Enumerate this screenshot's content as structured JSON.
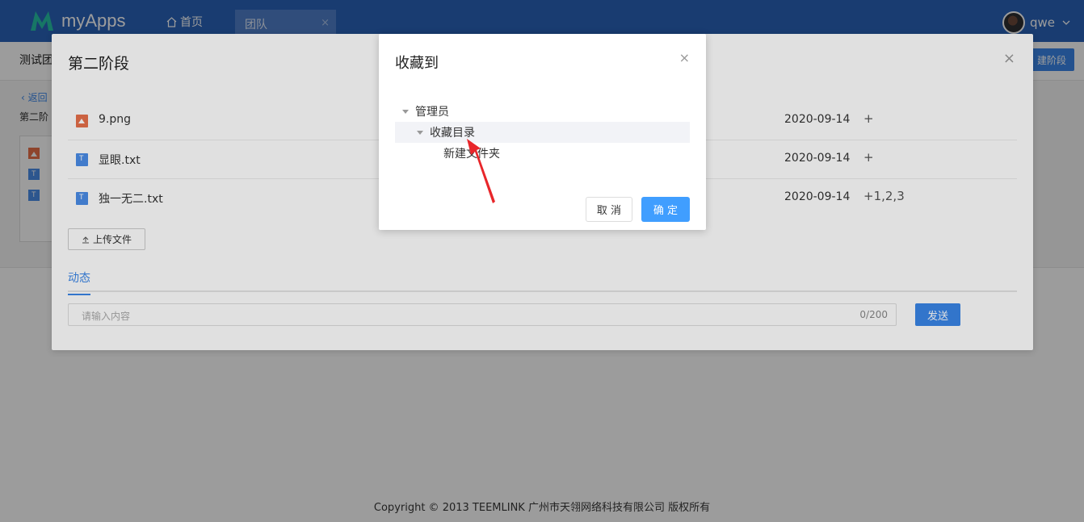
{
  "app": {
    "name": "myApps"
  },
  "nav": {
    "home_label": "首页",
    "tab_label": "团队",
    "tab_close": "×"
  },
  "user": {
    "name": "qwe"
  },
  "page": {
    "team_title": "测试团",
    "new_stage_label": "建阶段",
    "back_label": "返回",
    "stage_name": "第二阶"
  },
  "stage_modal": {
    "title": "第二阶段",
    "close": "×",
    "files": [
      {
        "name": "9.png",
        "type": "image",
        "date": "2020-09-14",
        "action": "+"
      },
      {
        "name": "显眼.txt",
        "type": "text",
        "date": "2020-09-14",
        "action": "+"
      },
      {
        "name": "独一无二.txt",
        "type": "text",
        "date": "2020-09-14",
        "action": "+1,2,3"
      }
    ],
    "upload_label": "上传文件",
    "tab_active": "动态",
    "comment_placeholder": "请输入内容",
    "comment_count": "0/200",
    "send_label": "发送"
  },
  "fav_modal": {
    "title": "收藏到",
    "close": "×",
    "tree": [
      {
        "label": "管理员",
        "level": 0,
        "expanded": true
      },
      {
        "label": "收藏目录",
        "level": 1,
        "expanded": true,
        "selected": true
      },
      {
        "label": "新建文件夹",
        "level": 2,
        "expanded": false
      }
    ],
    "cancel_label": "取 消",
    "ok_label": "确 定"
  },
  "footer": {
    "text": "Copyright © 2013 TEEMLINK 广州市天翎网络科技有限公司 版权所有"
  },
  "colors": {
    "header": "#2a63b9",
    "primary": "#409eff",
    "accent": "#3a86e8",
    "image_file": "#e8704a",
    "text_file": "#4b8de8",
    "annotation": "#e8262a"
  }
}
